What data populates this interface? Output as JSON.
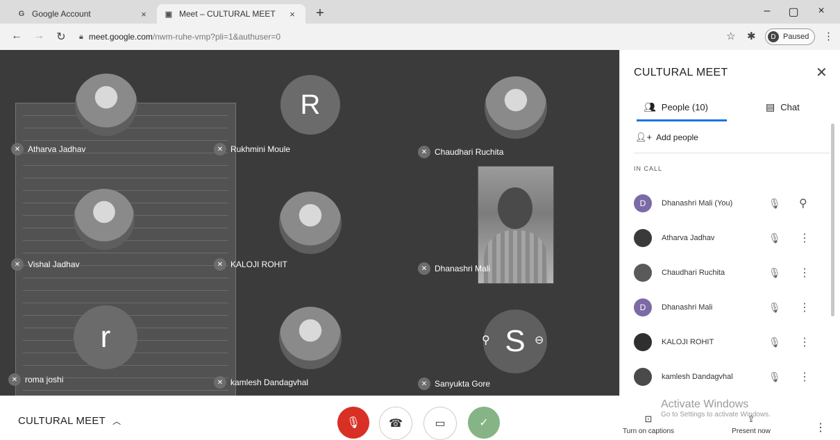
{
  "browser": {
    "tabs": [
      {
        "icon": "G",
        "title": "Google Account",
        "close": "×"
      },
      {
        "icon": "▣",
        "title": "Meet – CULTURAL MEET",
        "close": "×"
      }
    ],
    "new_tab": "+",
    "window_controls": {
      "minimize": "–",
      "maximize": "▢",
      "close": "×"
    },
    "url_host": "meet.google.com",
    "url_path": "/nwm-ruhe-vmp?pli=1&authuser=0",
    "profile_initial": "D",
    "profile_status": "Paused"
  },
  "stage": {
    "participants": [
      {
        "name": "Atharva Jadhav",
        "avatar": "photo"
      },
      {
        "name": "Rukhmini Moule",
        "avatar": "R"
      },
      {
        "name": "Chaudhari Ruchita",
        "avatar": "photo"
      },
      {
        "name": "Vishal Jadhav",
        "avatar": "photo"
      },
      {
        "name": "KALOJI ROHIT",
        "avatar": "photo"
      },
      {
        "name": "Dhanashri Mali",
        "avatar": "video"
      },
      {
        "name": "roma joshi",
        "avatar": "r"
      },
      {
        "name": "kamlesh Dandagvhal",
        "avatar": "photo"
      },
      {
        "name": "Sanyukta Gore",
        "avatar": "S"
      }
    ]
  },
  "bottom_bar": {
    "meeting_title": "CULTURAL MEET",
    "captions_label": "Turn on captions",
    "present_label": "Present now",
    "watermark_title": "Activate Windows",
    "watermark_sub": "Go to Settings to activate Windows."
  },
  "panel": {
    "title": "CULTURAL MEET",
    "people_tab": "People (10)",
    "chat_tab": "Chat",
    "add_people": "Add people",
    "section_label": "IN CALL",
    "people": [
      {
        "name": "Dhanashri Mali (You)",
        "initial": "D",
        "color": "#7b6aa6",
        "action": "pin"
      },
      {
        "name": "Atharva Jadhav",
        "initial": "",
        "color": "#3a3a3a",
        "action": "more"
      },
      {
        "name": "Chaudhari Ruchita",
        "initial": "",
        "color": "#5a5a5a",
        "action": "more"
      },
      {
        "name": "Dhanashri Mali",
        "initial": "D",
        "color": "#7b6aa6",
        "action": "more"
      },
      {
        "name": "KALOJI ROHIT",
        "initial": "",
        "color": "#2f2f2f",
        "action": "more"
      },
      {
        "name": "kamlesh Dandagvhal",
        "initial": "",
        "color": "#4a4a4a",
        "action": "more"
      }
    ]
  },
  "colors": {
    "stage_bg": "#3b3b3b",
    "accent": "#1a73e8",
    "end_call": "#d93025"
  }
}
